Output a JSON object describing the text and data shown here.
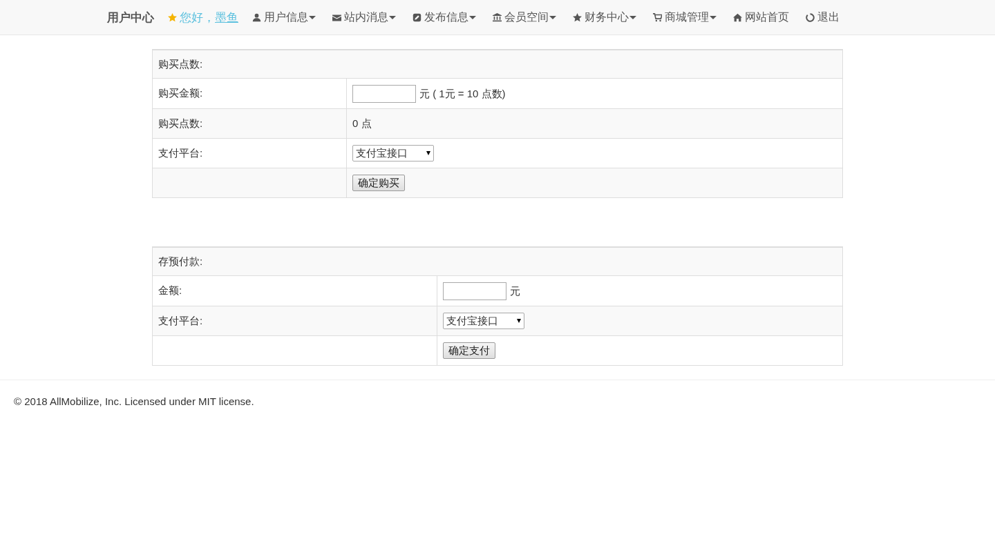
{
  "navbar": {
    "brand": "用户中心",
    "greeting": {
      "text": "您好，",
      "user": "墨鱼"
    },
    "items": [
      {
        "kind": "user",
        "label": "用户信息",
        "dropdown": true
      },
      {
        "kind": "envelope",
        "label": "站内消息",
        "dropdown": true
      },
      {
        "kind": "edit",
        "label": "发布信息",
        "dropdown": true
      },
      {
        "kind": "bank",
        "label": "会员空间",
        "dropdown": true
      },
      {
        "kind": "star",
        "label": "财务中心",
        "dropdown": true
      },
      {
        "kind": "cart",
        "label": "商城管理",
        "dropdown": true
      },
      {
        "kind": "home",
        "label": "网站首页",
        "dropdown": false
      },
      {
        "kind": "power",
        "label": "退出",
        "dropdown": false
      }
    ]
  },
  "forms": [
    {
      "title": "购买点数:",
      "rows": [
        {
          "kind": "input",
          "label": "购买金额:",
          "suffix": "元 ( 1元 = 10 点数)"
        },
        {
          "kind": "text",
          "label": "购买点数:",
          "value": "0 点"
        },
        {
          "kind": "select",
          "label": "支付平台:",
          "value": "支付宝接口"
        },
        {
          "kind": "button",
          "text": "确定购买"
        }
      ]
    },
    {
      "title": "存预付款:",
      "rows": [
        {
          "kind": "input",
          "label": "金额:",
          "suffix": "元"
        },
        {
          "kind": "select",
          "label": "支付平台:",
          "value": "支付宝接口"
        },
        {
          "kind": "button",
          "text": "确定支付"
        }
      ]
    }
  ],
  "footer": "© 2018 AllMobilize, Inc. Licensed under MIT license."
}
